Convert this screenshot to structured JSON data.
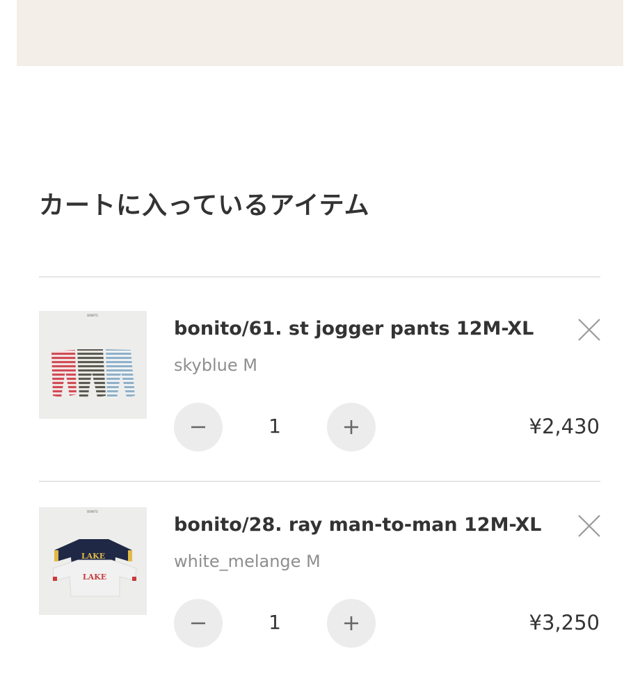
{
  "banner": {
    "color": "#f3eee7"
  },
  "cart": {
    "heading": "カートに入っているアイテム",
    "items": [
      {
        "name": "bonito/61. st jogger pants 12M-XL",
        "variant": "skyblue M",
        "quantity": "1",
        "price": "¥2,430",
        "image_label": "BONITO",
        "image_icon": "striped-jogger-pants-image"
      },
      {
        "name": "bonito/28. ray man-to-man 12M-XL",
        "variant": "white_melange M",
        "quantity": "1",
        "price": "¥3,250",
        "image_label": "BONITO",
        "image_text_top": "LAKE",
        "image_text_bottom": "LAKE",
        "image_icon": "lake-sweatshirts-image"
      }
    ]
  },
  "icons": {
    "remove": "close-icon",
    "decrease": "minus-icon",
    "increase": "plus-icon"
  },
  "colors": {
    "text": "#333333",
    "muted": "#8e8e8e",
    "divider": "#e6e6e6",
    "qty_button": "#ececec"
  }
}
